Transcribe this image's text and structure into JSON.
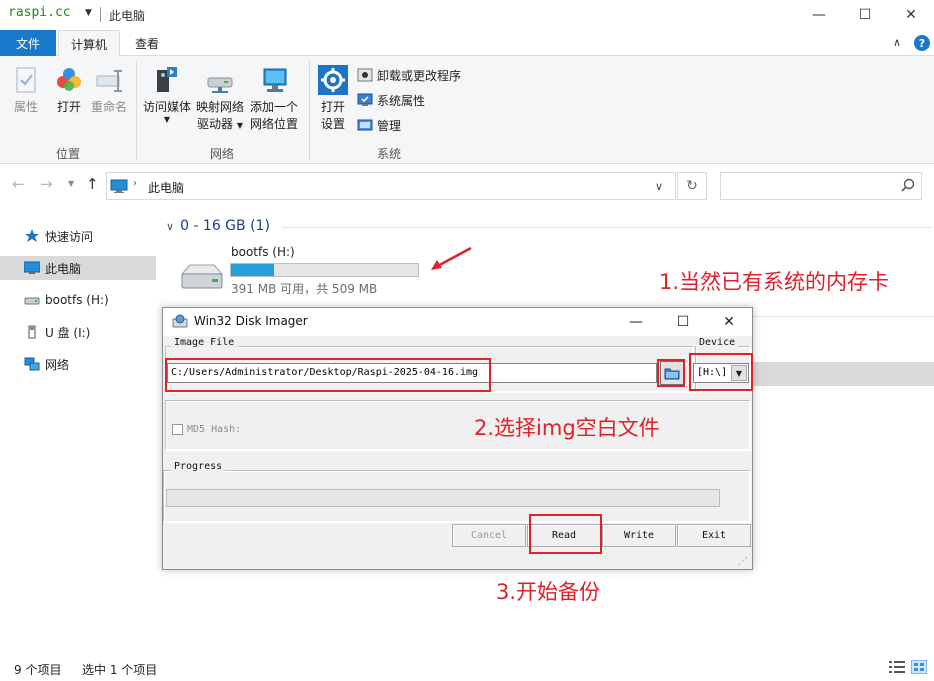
{
  "window": {
    "logo_text": "raspi.cc",
    "title": "此电脑",
    "minimize": "—",
    "maximize": "☐",
    "close": "✕"
  },
  "ribbon_tabs": [
    {
      "label": "文件"
    },
    {
      "label": "计算机"
    },
    {
      "label": "查看"
    }
  ],
  "ribbon": {
    "location": {
      "group": "位置",
      "properties": "属性",
      "open": "打开",
      "rename": "重命名"
    },
    "network": {
      "group": "网络",
      "access_media": "访问媒体",
      "map_drive_1": "映射网络",
      "map_drive_2": "驱动器",
      "add_location_1": "添加一个",
      "add_location_2": "网络位置"
    },
    "system": {
      "group": "系统",
      "open_settings_1": "打开",
      "open_settings_2": "设置",
      "uninstall": "卸载或更改程序",
      "system_properties": "系统属性",
      "manage": "管理"
    }
  },
  "address": {
    "path": "此电脑"
  },
  "sidebar": {
    "items": [
      {
        "label": "快速访问"
      },
      {
        "label": "此电脑"
      },
      {
        "label": "bootfs (H:)"
      },
      {
        "label": "U 盘 (I:)"
      },
      {
        "label": "网络"
      }
    ]
  },
  "content": {
    "group_header": "0 - 16 GB (1)",
    "drive": {
      "name": "bootfs (H:)",
      "free_text": "391 MB 可用，共 509 MB",
      "used_fraction": 0.232
    }
  },
  "status": {
    "item_count": "9 个项目",
    "selected": "选中 1 个项目"
  },
  "dialog": {
    "title": "Win32 Disk Imager",
    "image_file_label": "Image File",
    "image_path": "C:/Users/Administrator/Desktop/Raspi-2025-04-16.img",
    "device_label": "Device",
    "device_value": "[H:\\]",
    "md5_label": "MD5 Hash:",
    "progress_label": "Progress",
    "buttons": {
      "cancel": "Cancel",
      "read": "Read",
      "write": "Write",
      "exit": "Exit"
    }
  },
  "annotations": {
    "step1": "1.当然已有系统的内存卡",
    "step2": "2.选择img空白文件",
    "step3": "3.开始备份"
  },
  "colors": {
    "accent": "#1979ca",
    "annotation_red": "#e0202a",
    "drive_bar": "#26a0da",
    "logo_green": "#1b8a1b"
  }
}
